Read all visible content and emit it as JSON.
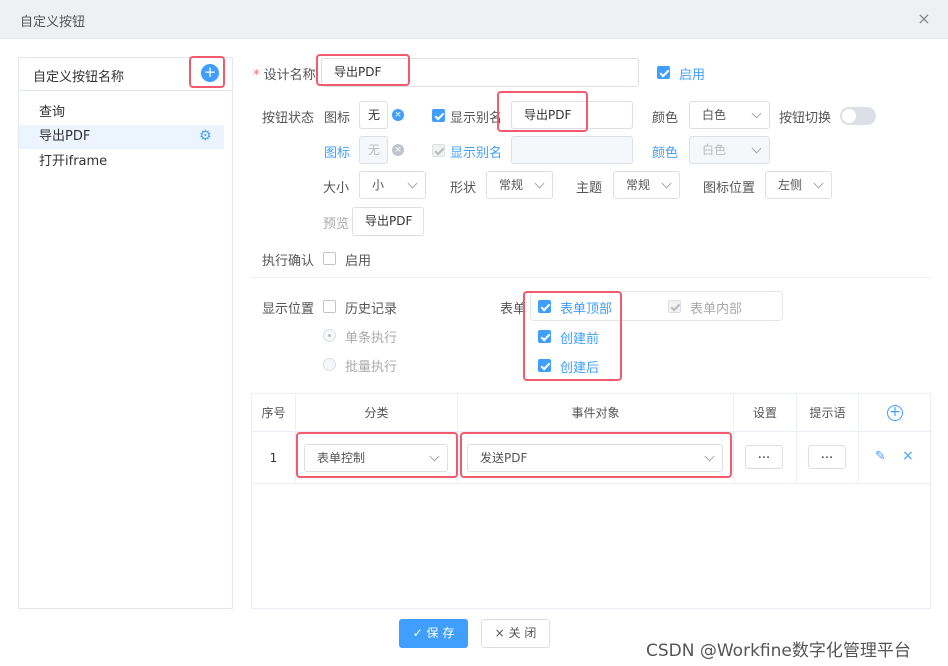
{
  "window": {
    "title": "自定义按钮",
    "close_icon": "×"
  },
  "sidebar": {
    "header": "自定义按钮名称",
    "add_icon": "+",
    "items": [
      {
        "label": "查询"
      },
      {
        "label": "导出PDF",
        "active": true
      },
      {
        "label": "打开iframe"
      }
    ]
  },
  "form": {
    "design_name": {
      "label": "设计名称",
      "required_mark": "*",
      "value": "导出PDF"
    },
    "enable": {
      "label": "启用",
      "checked": true
    },
    "button_state": {
      "label": "按钮状态",
      "row1": {
        "icon_label": "图标",
        "icon_value": "无",
        "alias_label": "显示别名",
        "alias_value": "导出PDF",
        "color_label": "颜色",
        "color_value": "白色",
        "toggle_label": "按钮切换"
      },
      "row2": {
        "icon_label": "图标",
        "icon_value": "无",
        "alias_label": "显示别名",
        "color_label": "颜色",
        "color_value": "白色"
      },
      "size": {
        "label": "大小",
        "value": "小"
      },
      "shape": {
        "label": "形状",
        "value": "常规"
      },
      "theme": {
        "label": "主题",
        "value": "常规"
      },
      "icon_position": {
        "label": "图标位置",
        "value": "左侧"
      },
      "preview": {
        "label": "预览",
        "button": "导出PDF"
      }
    },
    "confirm": {
      "label": "执行确认",
      "option": "启用"
    },
    "display": {
      "label": "显示位置",
      "history": "历史记录",
      "single": "单条执行",
      "batch": "批量执行",
      "form_label": "表单",
      "form_top": "表单顶部",
      "form_inner": "表单内部",
      "before_create": "创建前",
      "after_create": "创建后"
    }
  },
  "table": {
    "headers": [
      "序号",
      "分类",
      "事件对象",
      "设置",
      "提示语"
    ],
    "add_icon": "+",
    "rows": [
      {
        "index": "1",
        "category": "表单控制",
        "event": "发送PDF",
        "settings": "...",
        "tip": "..."
      }
    ]
  },
  "footer": {
    "save": "保 存",
    "save_icon": "✓",
    "close": "关 闭",
    "close_icon": "×"
  },
  "watermark": "CSDN @Workfine数字化管理平台",
  "colors": {
    "accent": "#409eff",
    "highlight": "#f25b6e"
  }
}
